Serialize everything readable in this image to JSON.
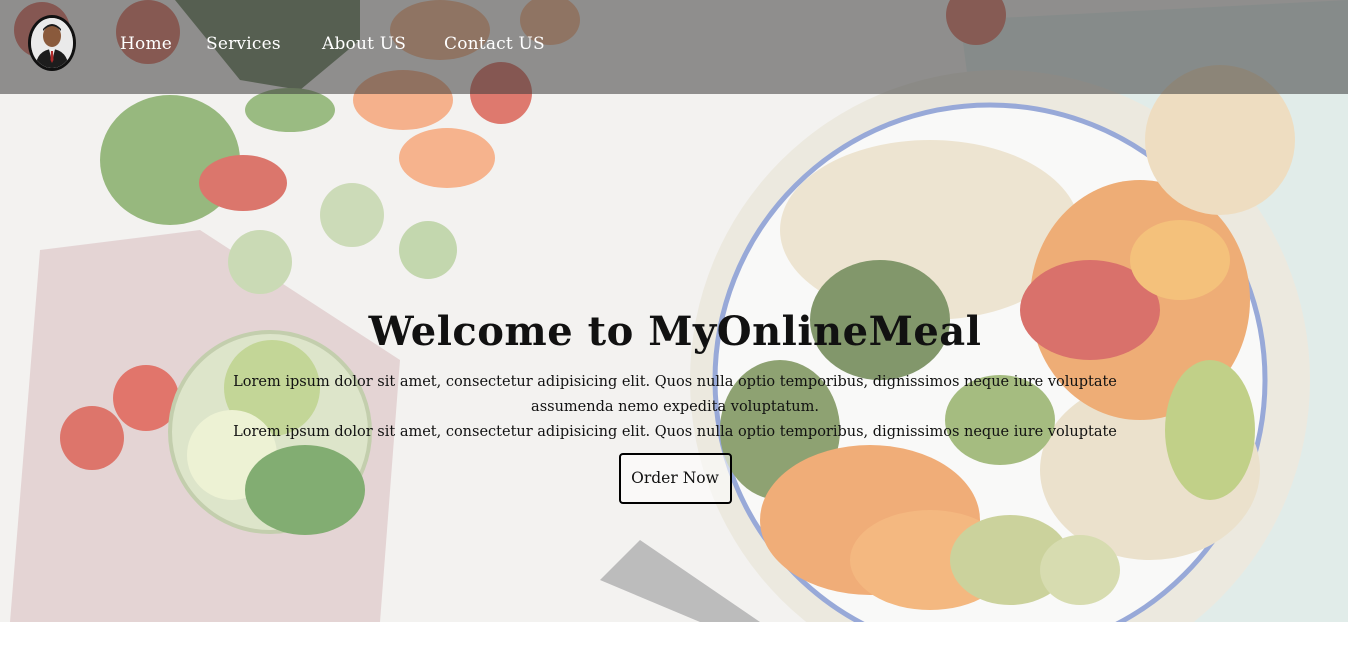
{
  "nav": {
    "logo_alt": "profile photo",
    "items": [
      {
        "label": "Home"
      },
      {
        "label": "Services"
      },
      {
        "label": "About US"
      },
      {
        "label": "Contact US"
      }
    ]
  },
  "hero": {
    "title": "Welcome to MyOnlineMeal",
    "paragraph_line1": "Lorem ipsum dolor sit amet, consectetur adipisicing elit. Quos nulla optio temporibus, dignissimos neque iure voluptate assumenda nemo expedita voluptatum.",
    "paragraph_line2": "Lorem ipsum dolor sit amet, consectetur adipisicing elit. Quos nulla optio temporibus, dignissimos neque iure voluptate",
    "cta_label": "Order Now"
  },
  "colors": {
    "navbar_bg": "#5a5a5a",
    "text": "#111111",
    "nav_text": "#ffffff"
  }
}
